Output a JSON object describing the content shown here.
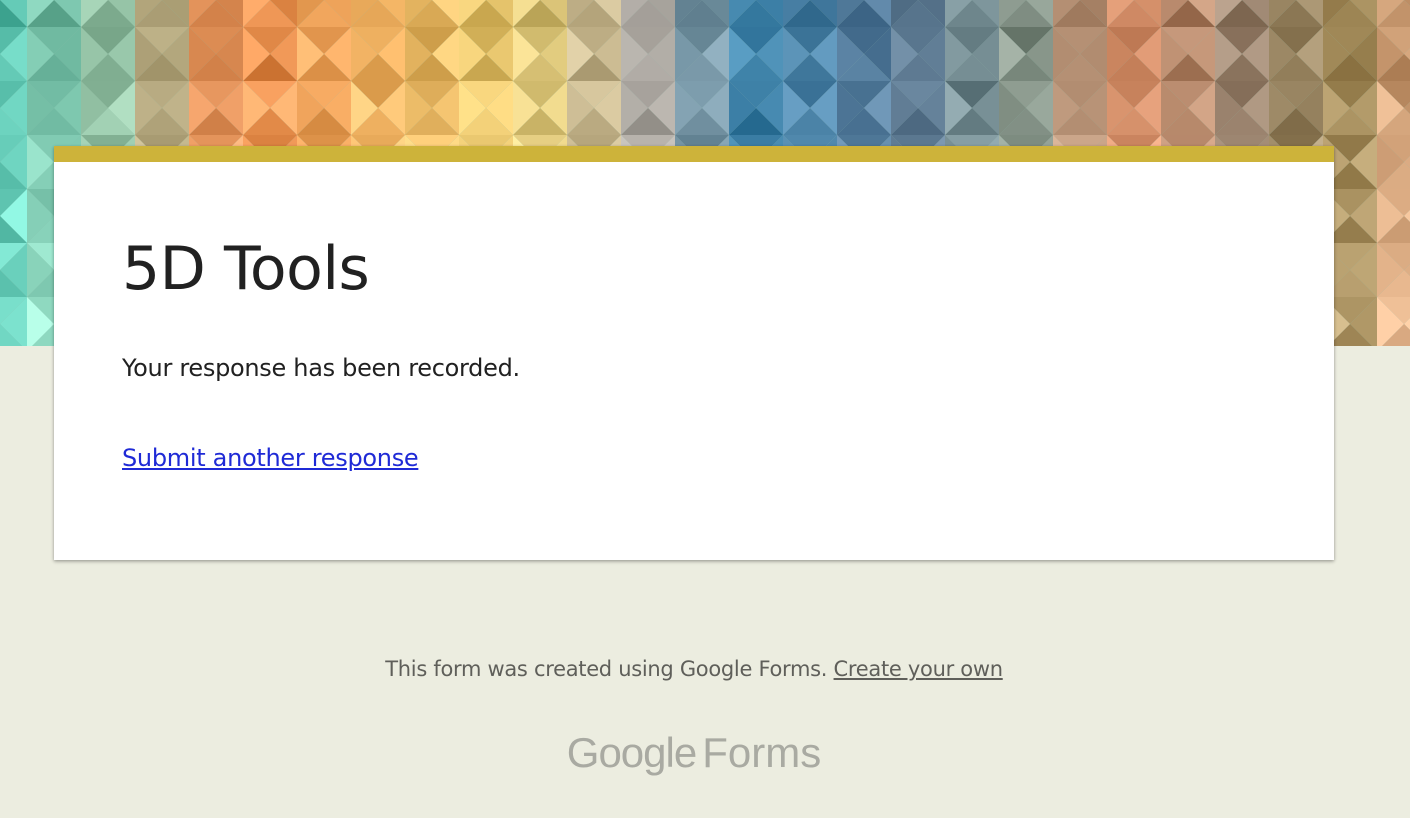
{
  "form": {
    "title": "5D Tools",
    "confirmation_message": "Your response has been recorded.",
    "submit_another_label": "Submit another response"
  },
  "footer": {
    "note_text": "This form was created using Google Forms.",
    "create_link_label": "Create your own"
  },
  "brand": {
    "google_text": "Google",
    "forms_text": "Forms",
    "icon": "google-forms-wordmark"
  },
  "colors": {
    "page_background": "#ecede0",
    "card_accent": "#cdb33a",
    "link": "#1f2ad6",
    "title_text": "#212121",
    "footer_text": "#5f5f5a",
    "brand_logo": "#a9aaa2"
  }
}
